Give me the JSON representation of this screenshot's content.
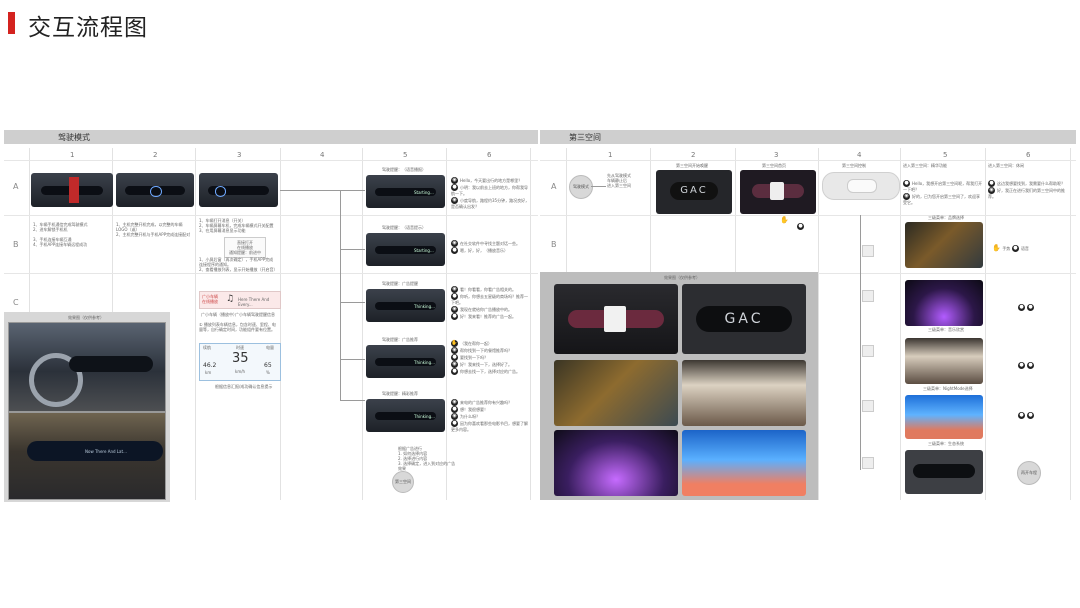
{
  "header": {
    "title": "交互流程图"
  },
  "left_section": {
    "label": "驾驶模式",
    "columns": [
      "1",
      "2",
      "3",
      "4",
      "5",
      "6"
    ],
    "rows": [
      "A",
      "B",
      "C"
    ],
    "notes": {
      "col1_b": "1、车辆手机通信完成驾驶模式\n2、进车解锁手机机\n\n3、手机连接车辆互通\n4、手机APP连接车辆远程成功",
      "col2_b": "1、主机完整开机完成，以完整的车辆LOGO（或）\n2、主机完整开机与手机APP完成连接配对",
      "col3_b": "1、车辆打开消息（开关）\n2、车辆屏幕车机，完成车辆模式开关配置\n3、在用屏幕消息显示功能",
      "col3_c1": "1、小屏后窗（再次确定），手机APP完成连接程序的通知。\n2、查看播放列表，显示开始播放（开启音）",
      "col3_c2": "① 播放列表车辆信息，包含时速、里程、电量等，自行确定时间，功能组件要有位置。",
      "col3_bubble": "直接打开\n在线播放\n通知提醒：前进中",
      "music_left": "广小车辆\n在线播放",
      "music_song": "Here There And Every...",
      "music_sub": "广小车辆（播放中）",
      "music_sub2": "广小车辆驾驶提醒信息",
      "speed_label_left": "续航",
      "speed_label_mid": "时速",
      "speed_label_right": "电量",
      "speed_value": "35",
      "speed_unit": "km/h",
      "range_value": "46.2",
      "range_unit": "km",
      "battery_value": "65",
      "battery_unit": "%",
      "speed_caption": "根据信息汇报/成功确认信息提示",
      "end_text": "根据广告进行\n1. 如何选择内容\n2. 选择进行内容\n3. 选择确定，进入到对应的广告效果",
      "end_circle": "第三空间"
    },
    "col5_cards": [
      {
        "label": "驾驶提醒：（语音播报）",
        "status": "Starting..."
      },
      {
        "label": "驾驶提醒：（语音提示）",
        "status": "Starting..."
      },
      {
        "label": "驾驶提醒：广告提醒",
        "status": "Thinking..."
      },
      {
        "label": "驾驶提醒：广告推荐",
        "status": "Thinking..."
      },
      {
        "label": "驾驶提醒：精彩推荐",
        "status": "Thinking..."
      }
    ],
    "col6_groups": [
      [
        "Hello，今天要出行的地方是哪里？",
        "小明：我以前去上班的地方，你帮我导航一下。",
        "小度导航，路程约35分钟，路况良好，是否确认出发？"
      ],
      [
        "在社交软件中寻找主题对话一些。",
        "嗯，好，好，（播放音乐）"
      ],
      [
        "看！你看看，你看广告相关的。",
        "你听，你想去五星级的商场吗？推荐一下吧。",
        "我现在就给你广告播放中的。",
        "好！我来看！推荐的广告一起。"
      ],
      [
        "（我在帮你一起）",
        "帮你找到一下的餐馆推荐吗？",
        "要找到一下吗？",
        "好！我来找一下，选择好了。",
        "你想去找一下，选择对应的广告。"
      ],
      [
        "来电的广告推荐你有兴趣吗？",
        "想！我很想要！",
        "为什么呀？",
        "因为你喜欢看那些电影节目，想要了解更多内容。"
      ]
    ],
    "photo_title": "效果图（仅供参考）",
    "photo_screen_text": "Now There And Lat..."
  },
  "right_section": {
    "label": "第三空间",
    "columns": [
      "1",
      "2",
      "3",
      "4",
      "5",
      "6"
    ],
    "rows": [
      "A",
      "B"
    ],
    "col1_circle": "驾驶模式",
    "col1_note": "先从驾驶模式\n车辆静止后\n进入第三空间",
    "col2_head": "第三空间开始唤醒",
    "col2_brand": "GAC",
    "col3_head": "第三空间首页",
    "col4_head": "第三空间控制",
    "col5_head": "进入第三空间：精华功能",
    "col6_head": "进入第三空间：休闲",
    "gallery_title": "效果图（仅供参考）",
    "gallery_brand": "GAC",
    "col5_cards": [
      {
        "label": "三级菜单：品牌选择"
      },
      {
        "label": "三级菜单：音乐欣赏"
      },
      {
        "label": "三级菜单：NightMode选择"
      },
      {
        "label": "三级菜单：生态系统"
      }
    ],
    "col56_a_lines": [
      "Hello，我想开启第三空间呢，帮我打开一下吧？",
      "好的，已为您开启第三空间了，欢迎享受它。"
    ],
    "col6_a_lines": [
      "这边我想要找到，我需要什么帮助呢？",
      "好，我正在进行我们的第三空间中的推荐。"
    ],
    "end_circle": "再开车程",
    "icon_caption_1": "手势",
    "icon_caption_2": "语音"
  }
}
